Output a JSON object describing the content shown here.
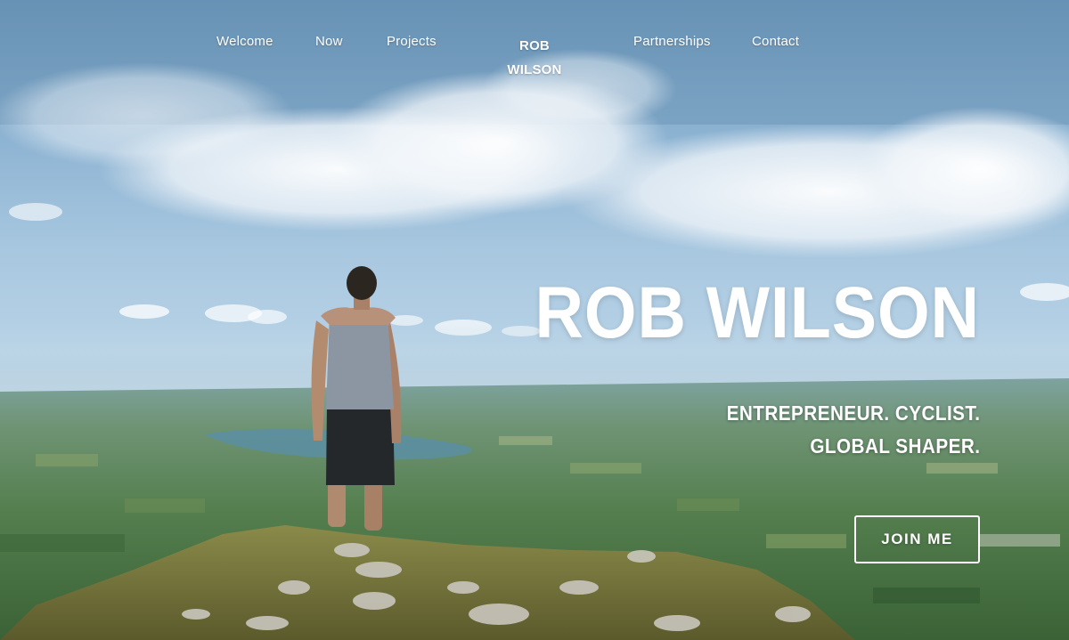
{
  "nav": {
    "items": [
      {
        "label": "Welcome"
      },
      {
        "label": "Now"
      },
      {
        "label": "Projects"
      },
      {
        "label": "Partnerships"
      },
      {
        "label": "Contact"
      }
    ],
    "logo_line1": "ROB",
    "logo_line2": "WILSON"
  },
  "hero": {
    "title": "ROB WILSON",
    "tagline_line1": "ENTREPRENEUR. CYCLIST.",
    "tagline_line2": "GLOBAL SHAPER.",
    "cta_label": "JOIN ME"
  },
  "colors": {
    "text": "#ffffff",
    "sky": "#8eb4d3",
    "landscape": "#4f7d55"
  }
}
